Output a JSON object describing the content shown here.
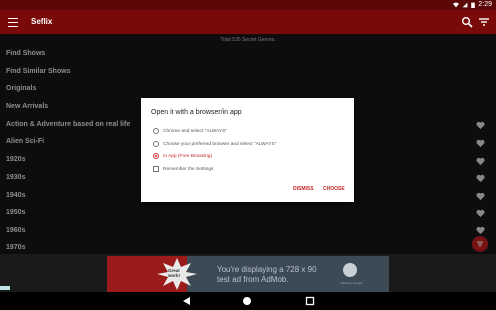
{
  "status_bar": {
    "time": "2:29"
  },
  "app_bar": {
    "title": "Seflix"
  },
  "header_info": {
    "text": "Total 535 Secret Genres."
  },
  "genres": [
    "Find Shows",
    "Find Similar Shows",
    "Originals",
    "New Arrivals",
    "Action & Adventure based on real life",
    "Alien Sci-Fi",
    "1920s",
    "1930s",
    "1940s",
    "1950s",
    "1960s",
    "1970s"
  ],
  "dialog": {
    "title": "Open it with a browser/in app",
    "options": [
      {
        "label": "Chrome and select \"ALWAYS\"",
        "selected": false
      },
      {
        "label": "Choose your preferred browser and select \"ALWAYS\"",
        "selected": false
      },
      {
        "label": "In App (Free Browsing)",
        "selected": true
      }
    ],
    "remember_label": "Remember the Settings",
    "dismiss_label": "DISMISS",
    "choose_label": "CHOOSE"
  },
  "ad": {
    "badge_text": "Great work!",
    "line1": "You're displaying a 728 x 90",
    "line2": "test ad from AdMob.",
    "caption": "AdMob by Google"
  },
  "colors": {
    "primary": "#7a0a0a",
    "status": "#5c0808",
    "accent": "#c62828"
  },
  "icons": {
    "menu": "hamburger-icon",
    "search": "search-icon",
    "filter": "filter-icon",
    "favorite": "heart-icon",
    "back": "back-triangle-icon",
    "home": "home-circle-icon",
    "recent": "recent-square-icon"
  }
}
